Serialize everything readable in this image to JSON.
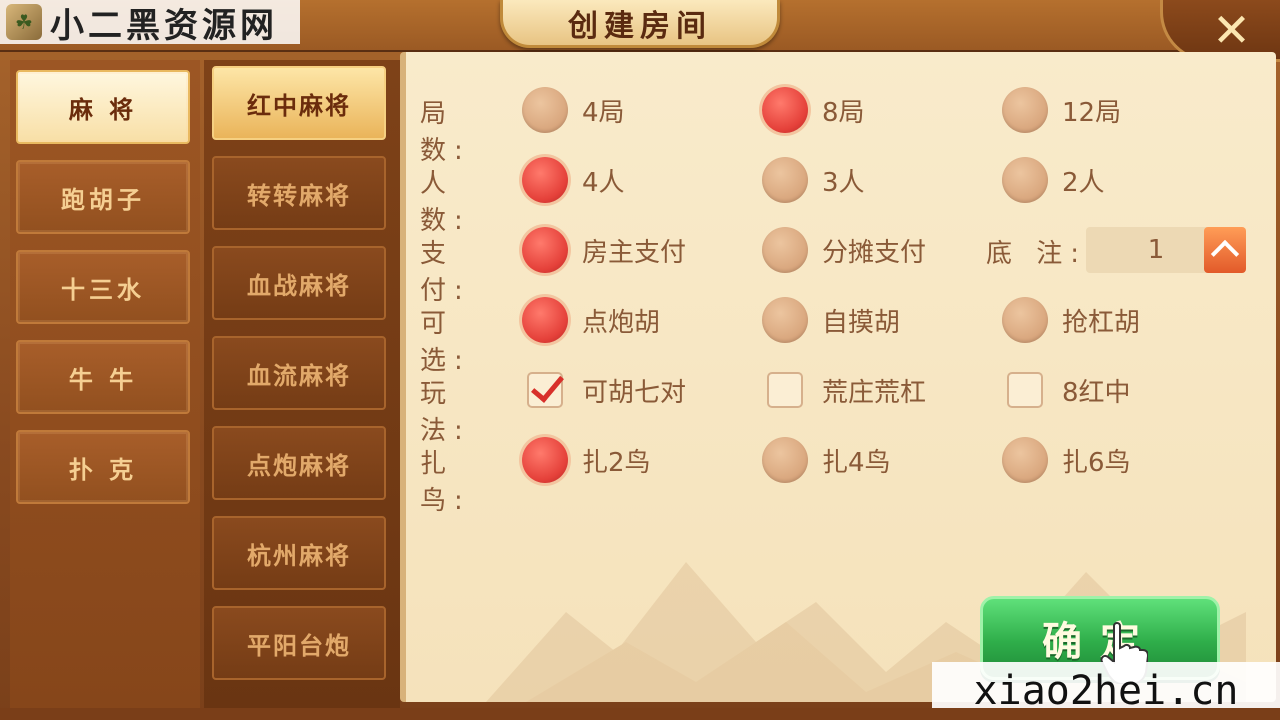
{
  "header": {
    "logo_text": "小二黑资源网",
    "title": "创建房间",
    "close_icon": "close-icon"
  },
  "categories": [
    {
      "label": "麻 将",
      "active": true
    },
    {
      "label": "跑胡子",
      "active": false
    },
    {
      "label": "十三水",
      "active": false
    },
    {
      "label": "牛 牛",
      "active": false
    },
    {
      "label": "扑 克",
      "active": false
    }
  ],
  "games": [
    {
      "label": "红中麻将",
      "active": true
    },
    {
      "label": "转转麻将",
      "active": false
    },
    {
      "label": "血战麻将",
      "active": false
    },
    {
      "label": "血流麻将",
      "active": false
    },
    {
      "label": "点炮麻将",
      "active": false
    },
    {
      "label": "杭州麻将",
      "active": false
    },
    {
      "label": "平阳台炮",
      "active": false
    }
  ],
  "settings": {
    "rounds": {
      "label": "局 数:",
      "options": [
        "4局",
        "8局",
        "12局"
      ],
      "selected": 1
    },
    "players": {
      "label": "人 数:",
      "options": [
        "4人",
        "3人",
        "2人"
      ],
      "selected": 0
    },
    "payment": {
      "label": "支 付:",
      "options": [
        "房主支付",
        "分摊支付"
      ],
      "selected": 0
    },
    "stake": {
      "label": "底 注:",
      "value": "1"
    },
    "optional": {
      "label": "可 选:",
      "options": [
        "点炮胡",
        "自摸胡",
        "抢杠胡"
      ],
      "selected": 0
    },
    "play": {
      "label": "玩 法:",
      "options": [
        "可胡七对",
        "荒庄荒杠",
        "8红中"
      ],
      "checked": [
        true,
        false,
        false
      ]
    },
    "birds": {
      "label": "扎 鸟:",
      "options": [
        "扎2鸟",
        "扎4鸟",
        "扎6鸟"
      ],
      "selected": 0
    }
  },
  "confirm_label": "确定",
  "watermark": "xiao2hei.cn",
  "colors": {
    "accent_red": "#e5413a",
    "confirm_green": "#2fae4a",
    "panel_bg": "#f9ebcb",
    "text_brown": "#8a5a38"
  }
}
